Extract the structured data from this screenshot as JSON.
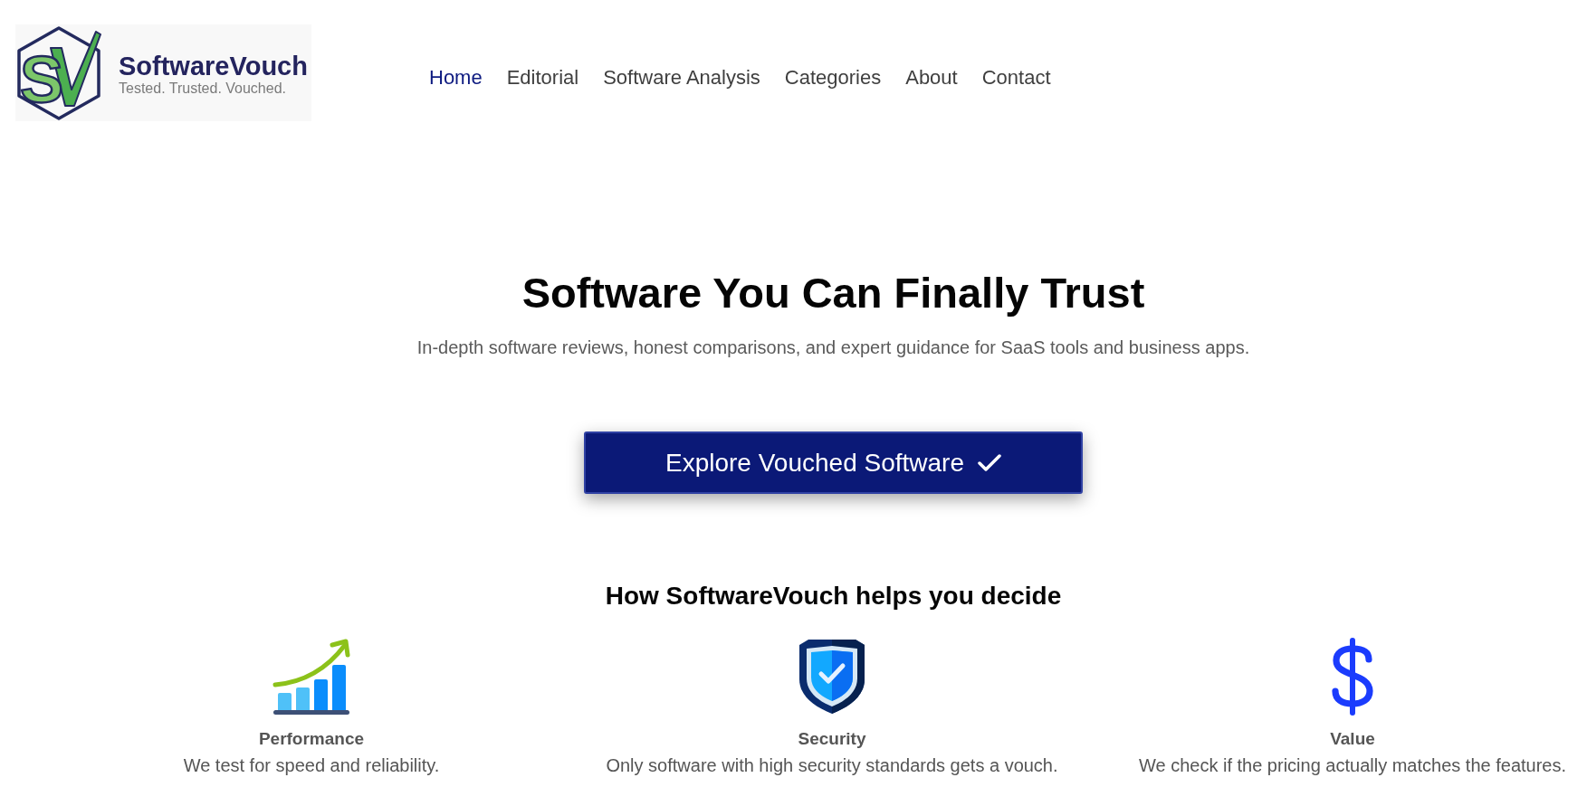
{
  "logo": {
    "monogram": "S",
    "name": "SoftwareVouch",
    "tagline": "Tested. Trusted. Vouched."
  },
  "nav": {
    "items": [
      {
        "label": "Home",
        "selected": true
      },
      {
        "label": "Editorial",
        "selected": false
      },
      {
        "label": "Software Analysis",
        "selected": false
      },
      {
        "label": "Categories",
        "selected": false
      },
      {
        "label": "About",
        "selected": false
      },
      {
        "label": "Contact",
        "selected": false
      }
    ]
  },
  "hero": {
    "title": "Software You Can Finally Trust",
    "subtitle": "In-depth software reviews, honest comparisons, and expert guidance for SaaS tools and business apps.",
    "button": {
      "label": "Explore Vouched Software"
    }
  },
  "features": {
    "heading": "How SoftwareVouch helps you decide",
    "items": [
      {
        "kind": "performance",
        "title": "Performance",
        "description": "We test for speed and reliability."
      },
      {
        "kind": "security",
        "title": "Security",
        "description": "Only software with high security standards gets a vouch."
      },
      {
        "kind": "value",
        "title": "Value",
        "description": "We check if the pricing actually matches the features."
      }
    ]
  }
}
